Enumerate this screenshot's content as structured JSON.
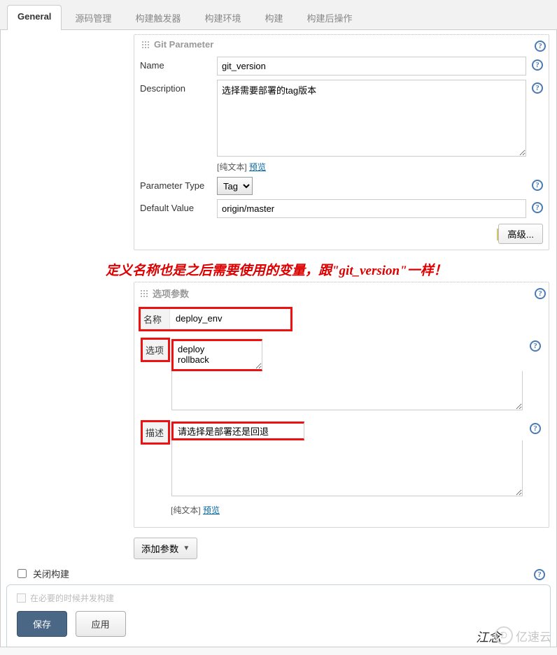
{
  "tabs": [
    "General",
    "源码管理",
    "构建触发器",
    "构建环境",
    "构建",
    "构建后操作"
  ],
  "gitParam": {
    "sectionTitle": "Git Parameter",
    "nameLabel": "Name",
    "nameValue": "git_version",
    "descLabel": "Description",
    "descValue": "选择需要部署的tag版本",
    "plainText": "[纯文本]",
    "preview": "预览",
    "paramTypeLabel": "Parameter Type",
    "paramTypeValue": "Tag",
    "defaultValueLabel": "Default Value",
    "defaultValue": "origin/master",
    "advanced": "高级..."
  },
  "annotation": "定义名称也是之后需要使用的变量，跟\"git_version\"一样！",
  "choiceParam": {
    "sectionTitle": "选项参数",
    "nameLabel": "名称",
    "nameValue": "deploy_env",
    "optionsLabel": "选项",
    "optionsValue": "deploy\nrollback",
    "descLabel": "描述",
    "descValue": "请选择是部署还是回退",
    "plainText": "[纯文本]",
    "preview": "预览"
  },
  "addParam": "添加参数",
  "closeBuild": "关闭构建",
  "footer": {
    "concurrent": "在必要的时候并发构建",
    "save": "保存",
    "apply": "应用"
  },
  "signature": "江念",
  "watermark": "亿速云"
}
